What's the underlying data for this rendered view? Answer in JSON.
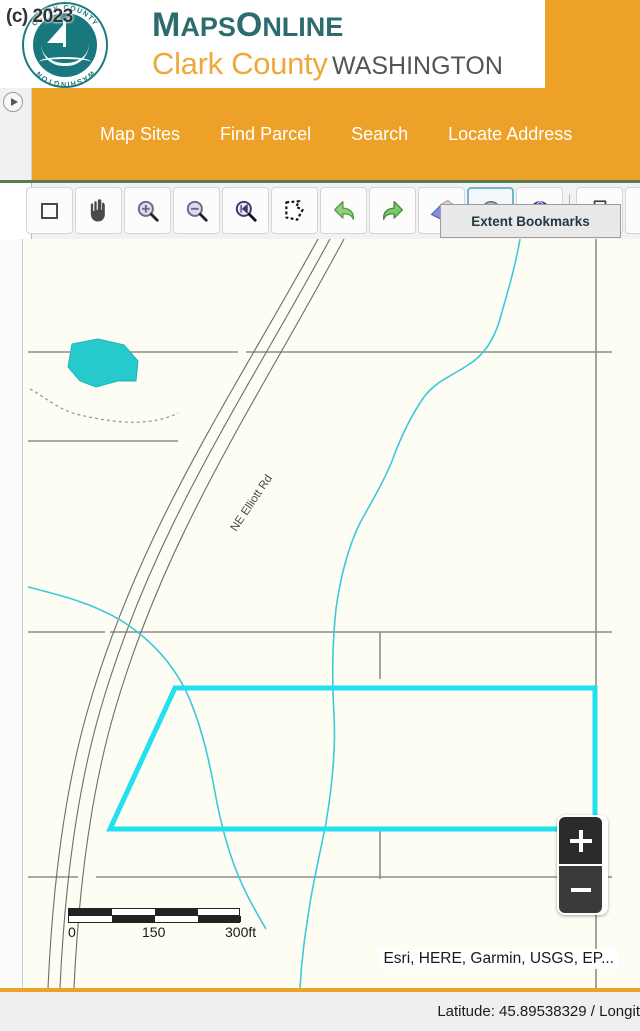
{
  "header": {
    "copyright": "(c) 2023",
    "logo_icon": "clark-county-seal-icon",
    "seal_text_top": "CLARK COUNTY",
    "seal_text_bottom": "WASHINGTON",
    "brand_maps": "M",
    "brand_aps": "APS",
    "brand_o": "O",
    "brand_nline": "NLINE",
    "brand_county": "Clark County",
    "brand_state": "WASHINGTON"
  },
  "nav": {
    "panel_toggle_icon": "expand-panel-icon",
    "items": [
      {
        "label": "Map Sites"
      },
      {
        "label": "Find Parcel"
      },
      {
        "label": "Search"
      },
      {
        "label": "Locate Address"
      }
    ]
  },
  "toolbar": {
    "tooltip": "Extent Bookmarks",
    "buttons": [
      {
        "name": "select-rectangle-tool",
        "icon": "rectangle-select-icon"
      },
      {
        "name": "pan-tool",
        "icon": "hand-icon"
      },
      {
        "name": "zoom-in-tool",
        "icon": "magnifier-plus-icon"
      },
      {
        "name": "zoom-out-tool",
        "icon": "magnifier-minus-icon"
      },
      {
        "name": "zoom-full-extent-tool",
        "icon": "magnifier-previous-icon"
      },
      {
        "name": "polygon-select-tool",
        "icon": "polygon-lasso-icon"
      },
      {
        "name": "previous-extent-button",
        "icon": "green-arrow-left-icon"
      },
      {
        "name": "next-extent-button",
        "icon": "green-arrow-right-icon"
      },
      {
        "name": "clear-graphics-button",
        "icon": "eraser-icon"
      },
      {
        "name": "extent-bookmarks-button",
        "icon": "bookmark-circle-icon"
      },
      {
        "name": "basemap-gallery-button",
        "icon": "blue-globe-icon"
      },
      {
        "name": "print-button",
        "icon": "printer-icon"
      },
      {
        "name": "measure-tool",
        "icon": "green-ruler-icon"
      }
    ]
  },
  "map": {
    "road_label": "NE Elliott Rd",
    "selected_parcel_color": "#21e0f0",
    "water_polygon_color": "#26c9cc",
    "stream_color": "#3ec8dc",
    "parcel_line_color": "#8d8d8d",
    "background_color": "#fdfdf3",
    "scalebar": {
      "min": "0",
      "mid": "150",
      "max": "300ft"
    },
    "attribution": "Esri, HERE, Garmin, USGS, EP...",
    "zoom_in_label": "+",
    "zoom_out_label": "−"
  },
  "status": {
    "coordinates": "Latitude: 45.89538329 / Longit"
  }
}
